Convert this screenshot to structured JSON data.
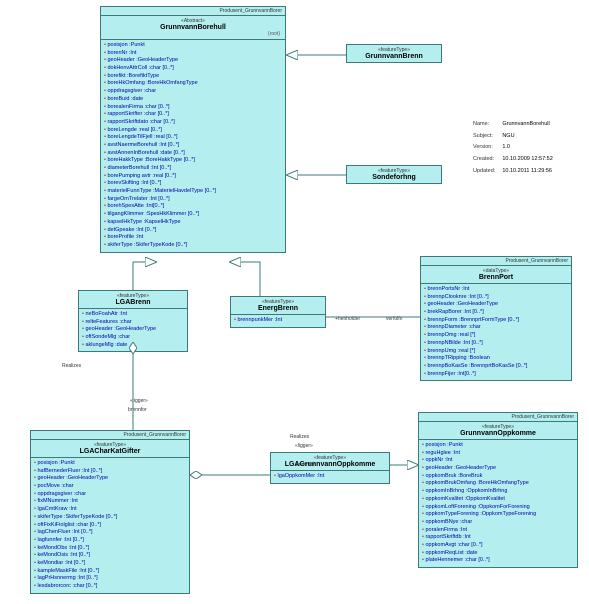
{
  "pkg": "Produsent_GrunnvannBorer",
  "boxes": {
    "main": {
      "stereo": "«Abstract»",
      "title": "GrunnvannBorehull",
      "role": "{root}",
      "attrs": [
        "posisjon :Punkt",
        "borenNr :Int",
        "geoHeader :GeoHeaderType",
        "dokHenvAttrColl :char [0..*]",
        "borefikt :BorefiktType",
        "boreHkOmfang :BoreHkOmfangType",
        "oppdragsgiver :char",
        "boreBuid :date",
        "borealenFirma :char [0..*]",
        "rapportSkrifter :char [0..*]",
        "rapportSkriftdato :char [0..*]",
        "boreLengde :real [0..*]",
        "boreLengdeTilFjell :real [0..*]",
        "avstNaermeBorehull :Int [0..*]",
        "avstAnnenInBorehull :date [0..*]",
        "boreHakkType :BoreHakkType [0..*]",
        "diameterBorehull :Int [0..*]",
        "borePumping avtr :real [0..*]",
        "borevSkifting :Int [0..*]",
        "materielFunnType :MaterielHavdelType [0..*]",
        "fargeOmTrelater :Int [0..*]",
        "borehSpesAtte :Int[0..*]",
        "tilgangKlimmer :SpesHkKlimmer [0..*]",
        "kapselHkType :KapselHkType",
        "detGpeake :Int [0..*]",
        "boreProfile :Int",
        "skiferType :SkiferTypeKode [0..*]"
      ]
    },
    "gBrenn": {
      "stereo": "«featureType»",
      "title": "GrunnvannBrenn"
    },
    "sonde": {
      "stereo": "«featureType»",
      "title": "Sondeforhng"
    },
    "lgb": {
      "stereo": "«featureType»",
      "title": "LGABrenn",
      "attrs": [
        "neBoFoahAtr :Int",
        "relteFeatures :char",
        "geoHeader :GeoHeaderType",
        "oftSondeMlg :char",
        "aklungeMlg :date"
      ]
    },
    "energi": {
      "stereo": "«featureType»",
      "title": "EnergBrenn",
      "attrs": [
        "brennpunkMer :Int"
      ]
    },
    "bPort": {
      "stereo": "«dataType»",
      "title": "BrennPort",
      "attrs": [
        "brennPortsNr :Int",
        "brennpClooknre :Int [0..*]",
        "geoHeader :GeoHeaderType",
        "brekRapBorer :Int [0..*]",
        "brennpForm :BrennprtFormType [0..*]",
        "brennpDiameter :char",
        "brennpOmg :real [*]",
        "brennpNBilde :Int [0..*]",
        "brennpUmg :real [*]",
        "brennpTRipping :Boolean",
        "brennpBoKasSe :BrennprtBoKasSe [0..*]",
        "brennpFijer :Int[0..*]"
      ]
    },
    "oppk": {
      "stereo": "«featureType»",
      "title": "GrunnvannOppkomme",
      "attrs": [
        "posisjon :Punkt",
        "reguHglee :Int",
        "oppkNr :Int",
        "geoHeader :GeoHeaderType",
        "oppkomBruk :BoreBruk",
        "oppkomBrukOmfang :BoreHkOmfangType",
        "oppkomInBrhng :OppkomInBrhng",
        "oppkomKvalitet :OppkomKvalitet",
        "oppkomLoftForening :OppkomForForening",
        "oppkomTypeForening :OppkomTypeForening",
        "oppkomBNye :char",
        "poralenFirma :Int",
        "rapportSkriftdb :Int",
        "oppkomAvgt :char [0..*]",
        "oppkomReqList :date",
        "plateHennemer :char [0..*]"
      ]
    },
    "lgbKart": {
      "stereo": "«featureType»",
      "title": "LGACharKatGifter",
      "attrs": [
        "posisjon :Punkt",
        "hafBernederFluer :Int [0..*]",
        "geoHeader :GeoHeaderType",
        "pocMove :char",
        "oppdragsgiver :char",
        "fixMNummer :Int",
        "lgaCmtKraw :Int",
        "skiferType :SkiferTypeKode [0..*]",
        "oftFixKiFiolglist :char [0..*]",
        "lagChenFluer :Int [0..*]",
        "lagfunnfer :Int [0..*]",
        "keMondObs :Int [0..*]",
        "keMondOsis :Int [0..*]",
        "keMondiar :Int [0..*]",
        "kampleMaskFile :Int [0..*]",
        "lagPrHsnnermg :Int [0..*]",
        "lesdabrorcorc :char [0..*]"
      ]
    },
    "lgbOpp": {
      "stereo": "«featureType»",
      "title": "LGAGrunnvannOppkomme",
      "attrs": [
        "lgaOppkomMer :Int"
      ]
    }
  },
  "meta": {
    "name_l": "Name:",
    "name_v": "GrunnvannBorehull",
    "subj_l": "Subject:",
    "subj_v": "NGU",
    "ver_l": "Version:",
    "ver_v": "1.0",
    "cre_l": "Created:",
    "cre_v": "10.10.2009 12:57:52",
    "upd_l": "Updated:",
    "upd_v": "10.10.2011 11:29:56"
  },
  "labels": {
    "realizes": "Realizes",
    "ligger": "«ligger»",
    "brennfor": "brennfor",
    "henholder": "+henholder",
    "verfolfn": "verfolfn"
  }
}
